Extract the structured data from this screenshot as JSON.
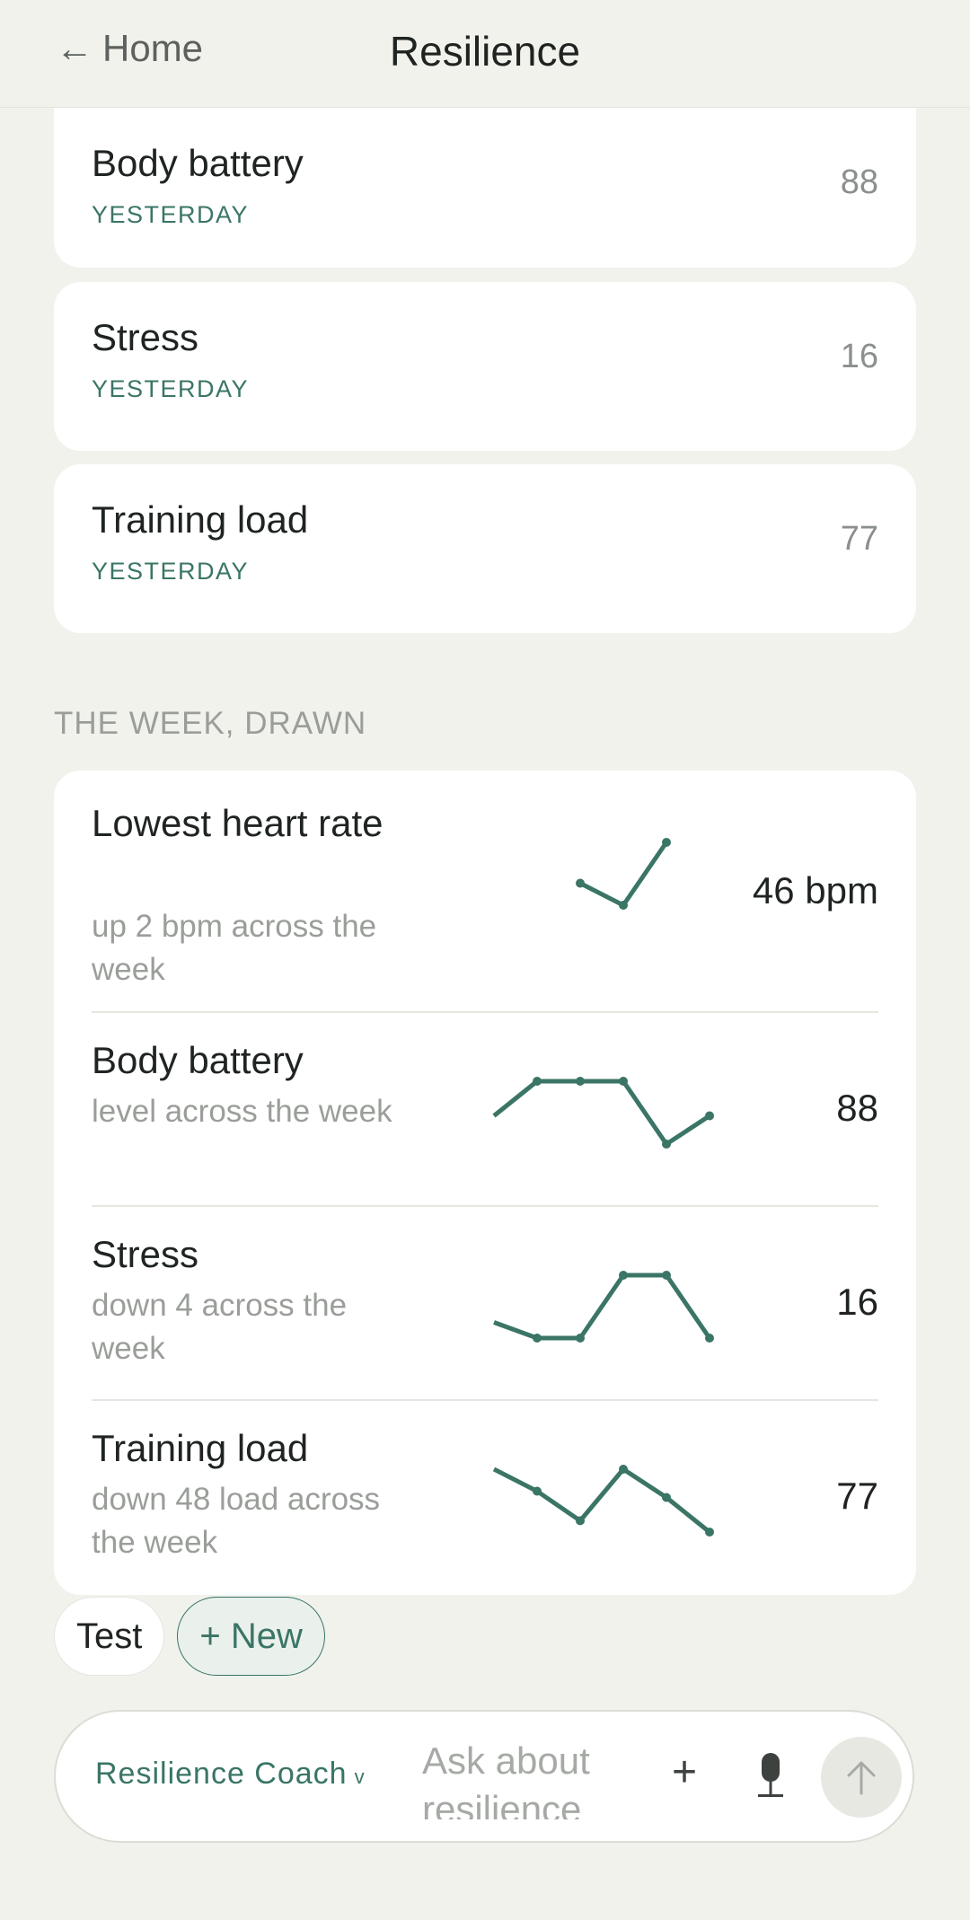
{
  "header": {
    "back_label": "Home",
    "title": "Resilience"
  },
  "metrics": [
    {
      "name": "Body battery",
      "when": "YESTERDAY",
      "value": "88"
    },
    {
      "name": "Stress",
      "when": "YESTERDAY",
      "value": "16"
    },
    {
      "name": "Training load",
      "when": "YESTERDAY",
      "value": "77"
    }
  ],
  "week": {
    "label": "THE WEEK, DRAWN",
    "rows": [
      {
        "title": "Lowest heart rate",
        "subtitle": "up 2 bpm across the week",
        "value": "46 bpm"
      },
      {
        "title": "Body battery",
        "subtitle": "level across the week",
        "value": "88"
      },
      {
        "title": "Stress",
        "subtitle": "down 4 across the week",
        "value": "16"
      },
      {
        "title": "Training load",
        "subtitle": "down 48 load across the week",
        "value": "77"
      }
    ]
  },
  "chart_data": [
    {
      "type": "line",
      "series": [
        {
          "values": [
            0.35,
            0.0,
            1.0
          ]
        }
      ],
      "start_index": 2
    },
    {
      "type": "line",
      "series": [
        {
          "values": [
            0.45,
            1.0,
            1.0,
            1.0,
            0.0,
            0.45
          ]
        }
      ],
      "start_index": 0
    },
    {
      "type": "line",
      "series": [
        {
          "values": [
            0.25,
            0.0,
            0.0,
            1.0,
            1.0,
            0.0
          ]
        }
      ],
      "start_index": 0
    },
    {
      "type": "line",
      "series": [
        {
          "values": [
            1.0,
            0.65,
            0.18,
            1.0,
            0.55,
            0.0
          ]
        }
      ],
      "start_index": 0
    }
  ],
  "chips": {
    "test_label": "Test",
    "new_label": "+ New"
  },
  "composer": {
    "coach_label": "Resilience Coach",
    "placeholder": "Ask about resilience"
  },
  "colors": {
    "accent": "#3a7566",
    "background": "#f2f2ed",
    "card": "#ffffff"
  }
}
